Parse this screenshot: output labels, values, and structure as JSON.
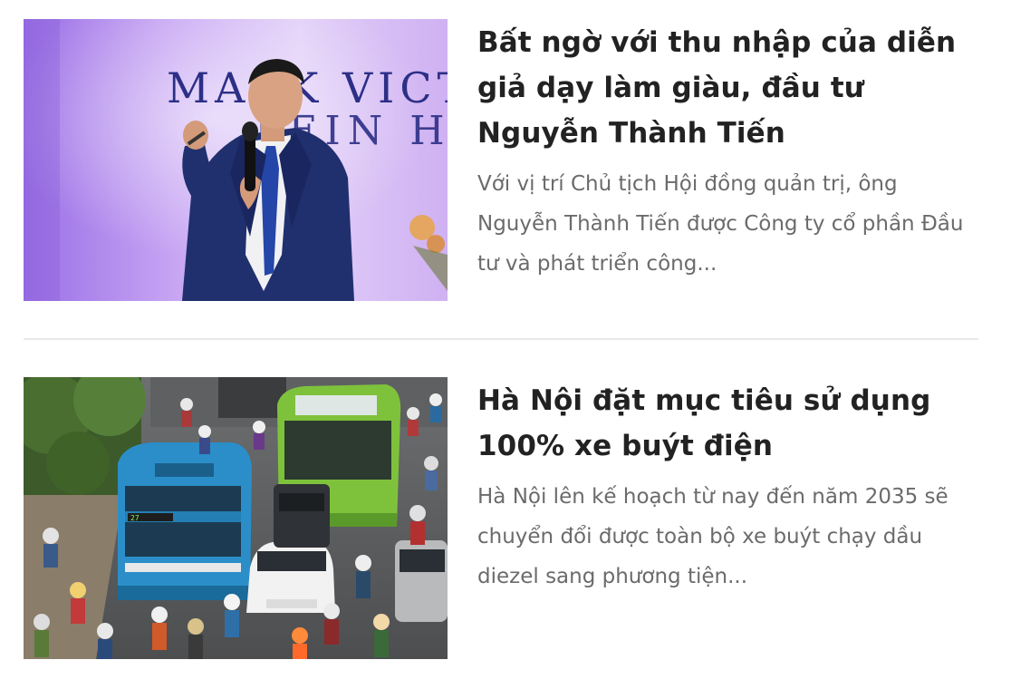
{
  "articles": [
    {
      "title": "Bất ngờ với thu nhập của diễn giả dạy làm giàu, đầu tư Nguyễn Thành Tiến",
      "description": "Với vị trí Chủ tịch Hội đồng quản trị, ông Nguyễn Thành Tiến được Công ty cổ phần Đầu tư và phát triển công...",
      "image_backdrop_text_1": "MARK VICT",
      "image_backdrop_text_2": "LEIN H"
    },
    {
      "title": "Hà Nội đặt mục tiêu sử dụng 100% xe buýt điện",
      "description": "Hà Nội lên kế hoạch từ nay đến năm 2035 sẽ chuyển đổi được toàn bộ xe buýt chạy dầu diezel sang phương tiện...",
      "bus_route_number": "27"
    }
  ],
  "colors": {
    "title": "#222222",
    "description": "#6b6b6b",
    "divider": "#e9e9ec"
  }
}
